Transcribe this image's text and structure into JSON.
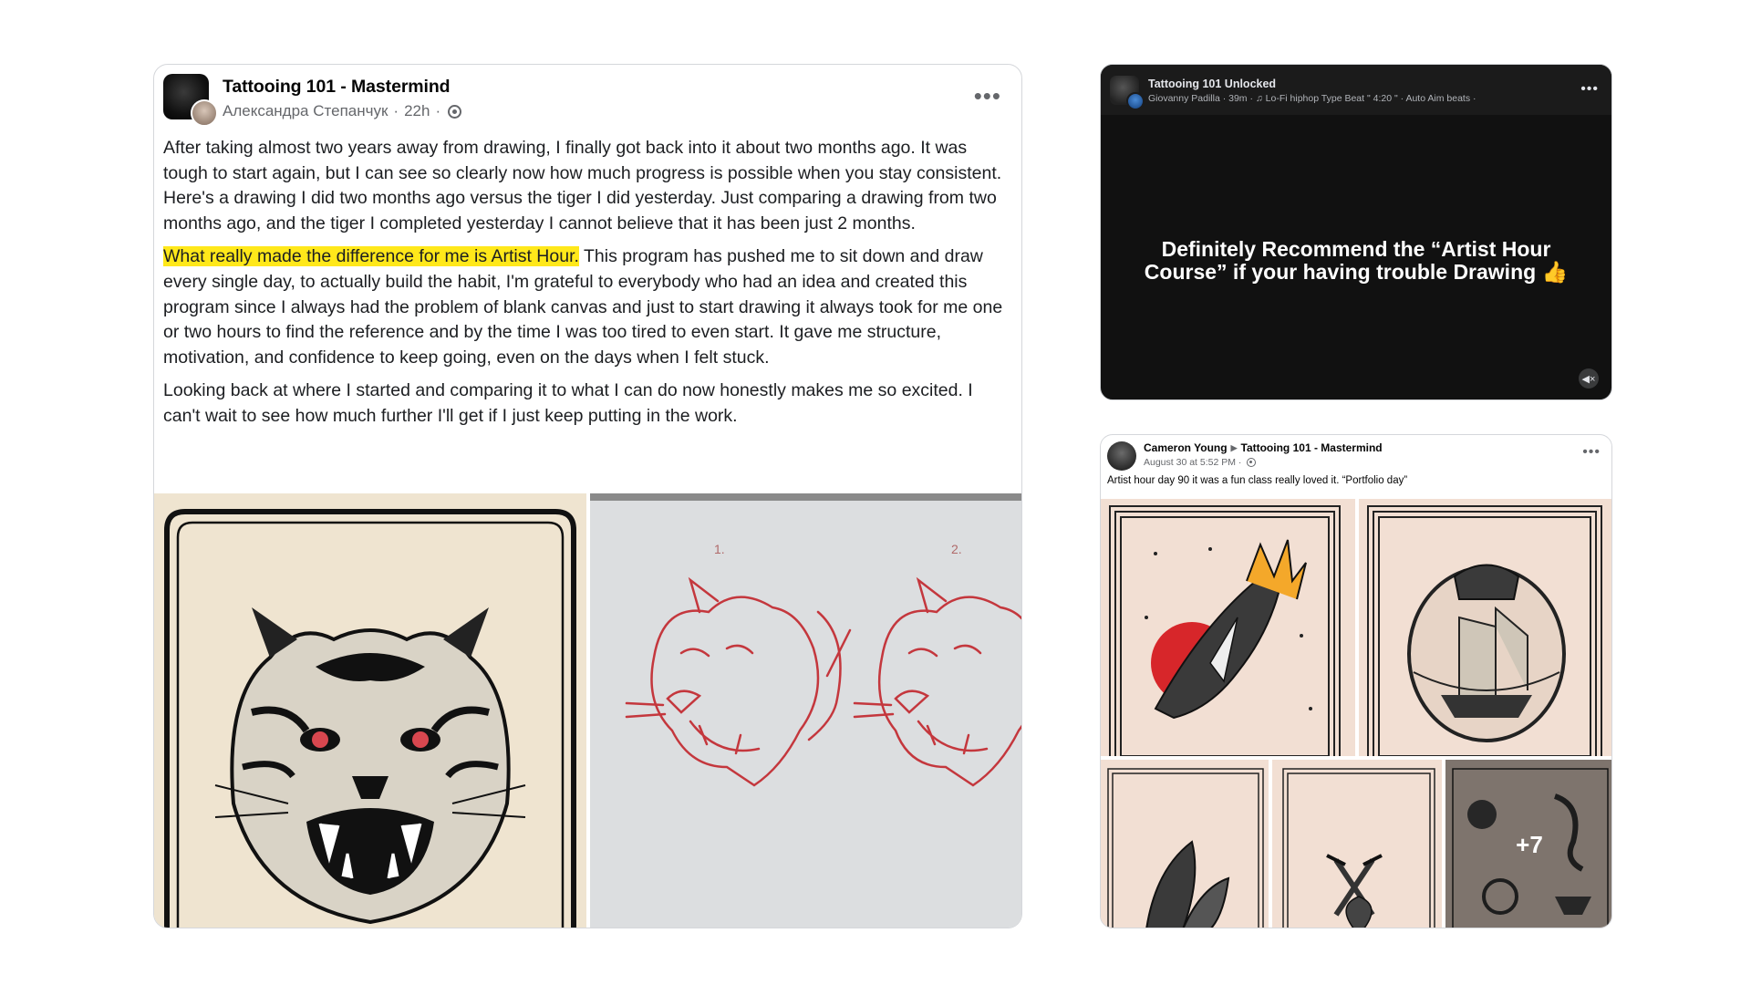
{
  "main_post": {
    "group_name": "Tattooing 101 - Mastermind",
    "author": "Александра Степанчук",
    "time": "22h",
    "paragraph_1": "After taking almost two years away from drawing, I finally got back into it about two months ago. It was tough to start again, but I can see so clearly now how much progress is possible when you stay consistent. Here's a drawing I did two months ago versus the tiger I did yesterday. Just comparing a drawing from two months ago, and the tiger I completed yesterday I cannot believe that it has been just 2 months.",
    "paragraph_2_highlight": "What really made the difference for me is Artist Hour.",
    "paragraph_2_rest": " This program has pushed me to sit down and draw every single day, to actually build the habit, I'm grateful to everybody who had an idea and created this program since I always had the problem of blank canvas and just to start drawing it always took for me one or two hours to find the reference and by the time I was too tired to even start. It gave me structure, motivation, and confidence to keep going, even on the days when I felt stuck.",
    "paragraph_3": "Looking back at where I started and comparing it to what I can do now honestly makes me so excited. I can't wait to see how much further I'll get if I just keep putting in the work.",
    "sketch_labels": [
      "1.",
      "2."
    ]
  },
  "video_post": {
    "group_name": "Tattooing 101 Unlocked",
    "meta": "Giovanny Padilla · 39m · ♫ Lo-Fi hiphop Type Beat \" 4:20 \" · Auto Aim beats ·",
    "caption_line1": "Definitely Recommend the “Artist Hour",
    "caption_line2": "Course” if your having trouble Drawing 👍"
  },
  "second_post": {
    "author": "Cameron Young",
    "group_name": "Tattooing 101 - Mastermind",
    "time": "August 30 at 5:52 PM ·",
    "text": "Artist hour day 90 it was a fun class really loved it. “Portfolio day”",
    "more_count": "+7"
  },
  "colors": {
    "highlight": "#ffe81a",
    "video_bg": "#111111",
    "sketch_red": "#c4373d",
    "tile_bg": "#f0ddd1"
  },
  "icons": [
    "more-icon",
    "globe-icon",
    "mute-icon",
    "arrow-right-icon"
  ]
}
